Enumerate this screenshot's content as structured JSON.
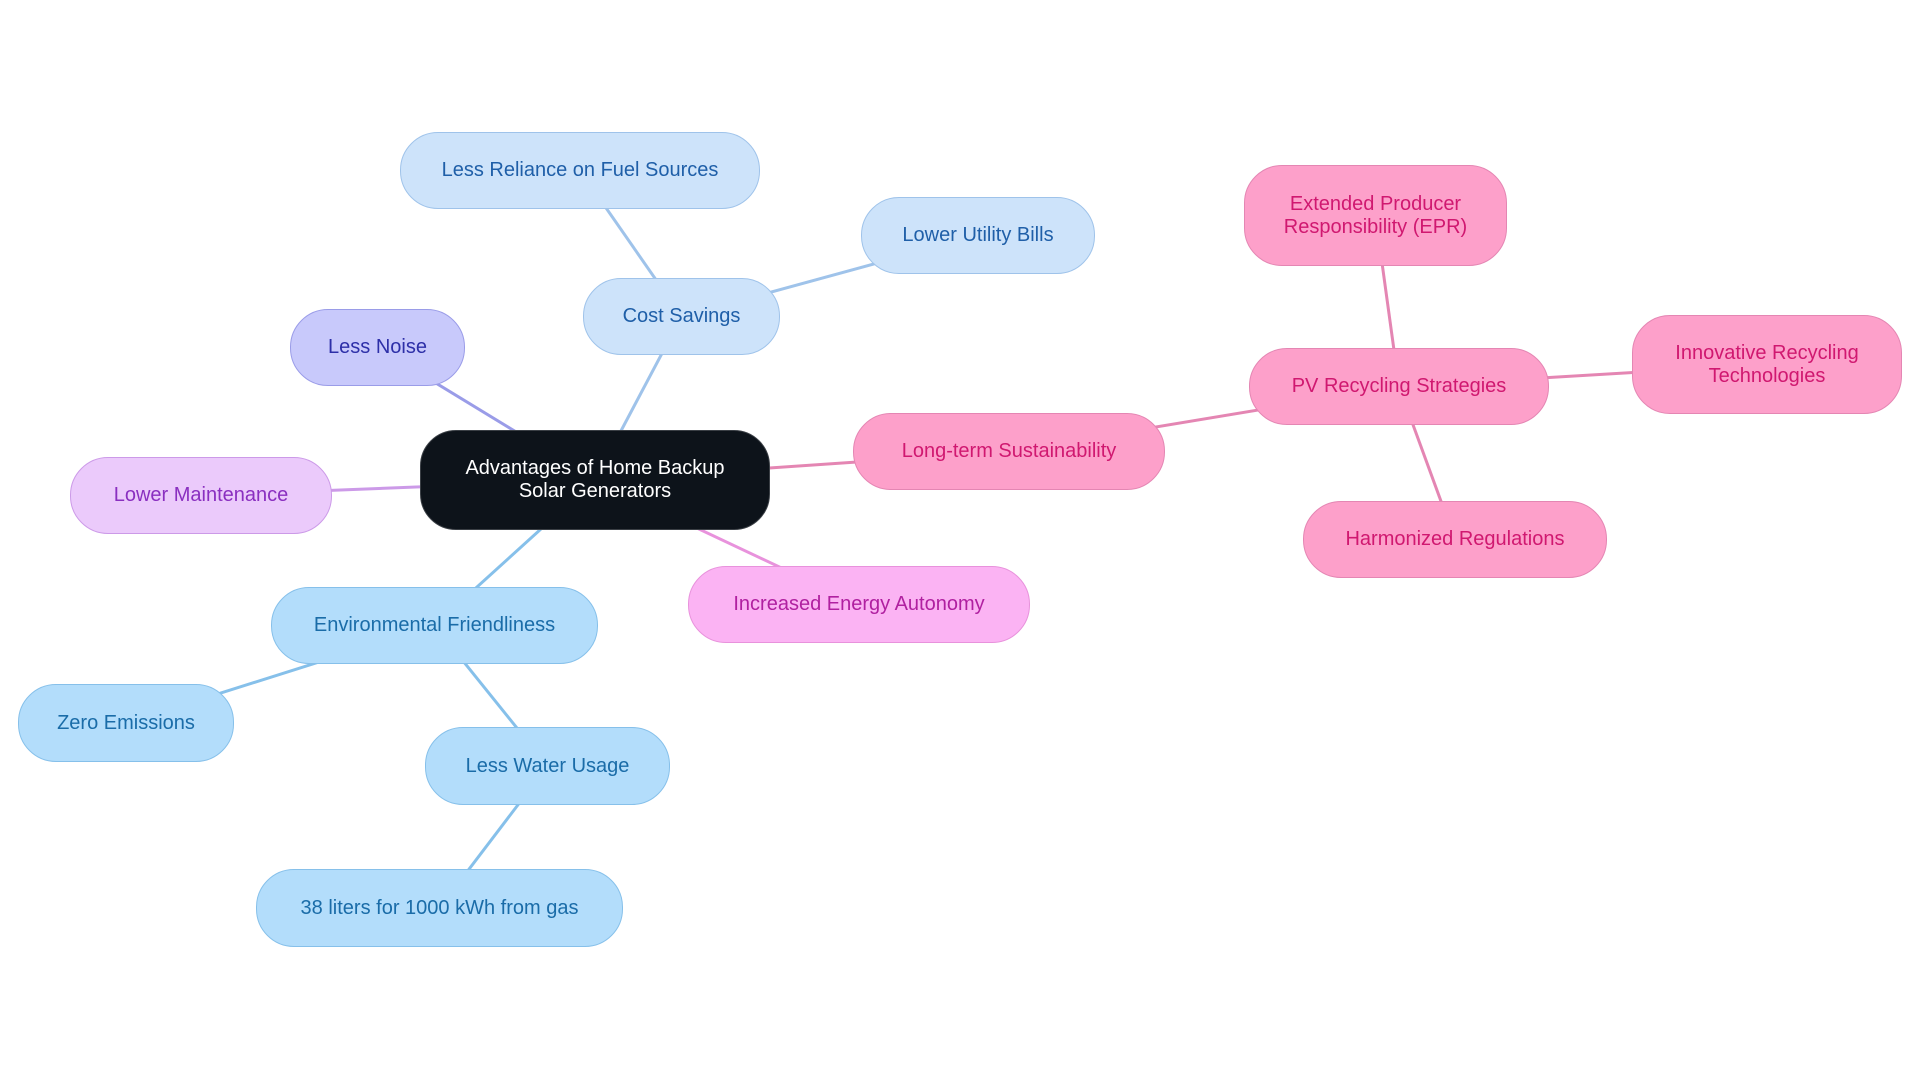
{
  "title": "Advantages of Home Backup Solar Generators",
  "palette": {
    "root": {
      "fill": "#0d131a",
      "stroke": "#3a3f45",
      "text": "#ffffff"
    },
    "blue_light": {
      "fill": "#cde3fa",
      "stroke": "#9fc3ea",
      "text": "#1f5fa8",
      "edge": "#9fc3ea"
    },
    "blue_sky": {
      "fill": "#b3ddfb",
      "stroke": "#86c0ea",
      "text": "#1a6ca8",
      "edge": "#86c0ea"
    },
    "indigo": {
      "fill": "#c8c9fb",
      "stroke": "#9a9ce8",
      "text": "#2d2fa8",
      "edge": "#9a9ce8"
    },
    "purple": {
      "fill": "#ebcafb",
      "stroke": "#cc9ae8",
      "text": "#8a2fc0",
      "edge": "#cc9ae8"
    },
    "magenta": {
      "fill": "#fbb3f3",
      "stroke": "#e892dc",
      "text": "#b020a0",
      "edge": "#e892dc"
    },
    "pink": {
      "fill": "#fda0ca",
      "stroke": "#e486b3",
      "text": "#d01870",
      "edge": "#e486b3"
    }
  },
  "nodes": [
    {
      "id": "root",
      "label": "Advantages of Home Backup\nSolar Generators",
      "color": "root"
    },
    {
      "id": "cost",
      "label": "Cost Savings",
      "color": "blue_light",
      "parent": "root"
    },
    {
      "id": "fuel",
      "label": "Less Reliance on Fuel Sources",
      "color": "blue_light",
      "parent": "cost"
    },
    {
      "id": "bills",
      "label": "Lower Utility Bills",
      "color": "blue_light",
      "parent": "cost"
    },
    {
      "id": "noise",
      "label": "Less Noise",
      "color": "indigo",
      "parent": "root"
    },
    {
      "id": "maint",
      "label": "Lower Maintenance",
      "color": "purple",
      "parent": "root"
    },
    {
      "id": "env",
      "label": "Environmental Friendliness",
      "color": "blue_sky",
      "parent": "root"
    },
    {
      "id": "zero",
      "label": "Zero Emissions",
      "color": "blue_sky",
      "parent": "env"
    },
    {
      "id": "water",
      "label": "Less Water Usage",
      "color": "blue_sky",
      "parent": "env"
    },
    {
      "id": "liters",
      "label": "38 liters for 1000 kWh from gas",
      "color": "blue_sky",
      "parent": "water"
    },
    {
      "id": "autonomy",
      "label": "Increased Energy Autonomy",
      "color": "magenta",
      "parent": "root"
    },
    {
      "id": "sustain",
      "label": "Long-term Sustainability",
      "color": "pink",
      "parent": "root"
    },
    {
      "id": "pv",
      "label": "PV Recycling Strategies",
      "color": "pink",
      "parent": "sustain"
    },
    {
      "id": "epr",
      "label": "Extended Producer\nResponsibility (EPR)",
      "color": "pink",
      "parent": "pv"
    },
    {
      "id": "innov",
      "label": "Innovative Recycling\nTechnologies",
      "color": "pink",
      "parent": "pv"
    },
    {
      "id": "harm",
      "label": "Harmonized Regulations",
      "color": "pink",
      "parent": "pv"
    }
  ]
}
